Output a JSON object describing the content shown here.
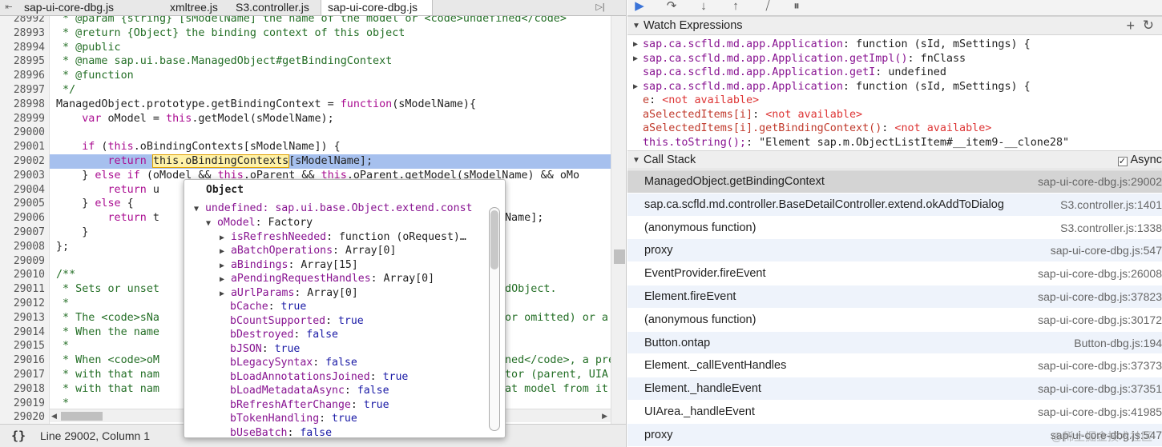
{
  "tabs": [
    {
      "label": "sap-ui-core-dbg.js",
      "active": false
    },
    {
      "label": "xmltree.js",
      "active": false
    },
    {
      "label": "S3.controller.js",
      "active": false
    },
    {
      "label": "sap-ui-core-dbg.js",
      "active": true
    }
  ],
  "editor": {
    "lines": [
      "28992",
      "28993",
      "28994",
      "28995",
      "28996",
      "28997",
      "28998",
      "28999",
      "29000",
      "29001",
      "29002",
      "29003",
      "29004",
      "29005",
      "29006",
      "29007",
      "29008",
      "29009",
      "29010",
      "29011",
      "29012",
      "29013",
      "29014",
      "29015",
      "29016",
      "29017",
      "29018",
      "29019",
      "29020"
    ],
    "code": {
      "l0": " * @param {string} [sModelName] the name of the model or <code>undefined</code>",
      "l1": " * @return {Object} the binding context of this object",
      "l2": " * @public",
      "l3": " * @name sap.ui.base.ManagedObject#getBindingContext",
      "l4": " * @function",
      "l5": " */",
      "l6a": "ManagedObject.prototype.getBindingContext = ",
      "l6b": "function",
      "l6c": "(sModelName){",
      "l7a": "    ",
      "l7b": "var",
      "l7c": " oModel = ",
      "l7d": "this",
      "l7e": ".getModel(sModelName);",
      "l9a": "    ",
      "l9b": "if",
      "l9c": " (",
      "l9d": "this",
      "l9e": ".oBindingContexts[sModelName]) {",
      "l10a": "        ",
      "l10b": "return",
      "l10c": " ",
      "l10d": "this.oBindingContexts",
      "l10e": "[sModelName];",
      "l11a": "    } ",
      "l11b": "else if",
      "l11c": " (oModel && ",
      "l11d": "this",
      "l11e": ".oParent && ",
      "l11f": "this",
      "l11g": ".oParent.getModel(sModelName) && oMo",
      "l12a": "        ",
      "l12b": "return",
      "l12c": " u",
      "l13a": "    } ",
      "l13b": "else",
      "l13c": " {",
      "l14a": "        ",
      "l14b": "return",
      "l14c": " t",
      "l14d": "Name];",
      "l15": "    }",
      "l16": "};",
      "l18": "/**",
      "l19a": " * Sets or unset",
      "l19b": "edObject.",
      "l20": " *",
      "l21a": " * The <code>sNa",
      "l21b": "or omitted) or a",
      "l22a": " * When the name",
      "l23": " *",
      "l24a": " * When <code>oM",
      "l24b": "ned</code>, a pre",
      "l25a": " * with that nam",
      "l25b": "tor (parent, UIA",
      "l26a": " * with that nam",
      "l26b": "at model from it",
      "l27": " *"
    }
  },
  "status": {
    "text": "Line 29002, Column 1",
    "braces": "{}"
  },
  "popover": {
    "title": "Object",
    "root": "undefined: sap.ui.base.Object.extend.const",
    "model": {
      "key": "oModel",
      "value": "Factory"
    },
    "props": [
      {
        "key": "isRefreshNeeded",
        "value": "function (oRequest)…",
        "type": "obj",
        "expand": true
      },
      {
        "key": "aBatchOperations",
        "value": "Array[0]",
        "type": "obj",
        "expand": true
      },
      {
        "key": "aBindings",
        "value": "Array[15]",
        "type": "obj",
        "expand": true
      },
      {
        "key": "aPendingRequestHandles",
        "value": "Array[0]",
        "type": "obj",
        "expand": true
      },
      {
        "key": "aUrlParams",
        "value": "Array[0]",
        "type": "obj",
        "expand": true
      },
      {
        "key": "bCache",
        "value": "true",
        "type": "bool",
        "expand": false
      },
      {
        "key": "bCountSupported",
        "value": "true",
        "type": "bool",
        "expand": false
      },
      {
        "key": "bDestroyed",
        "value": "false",
        "type": "bool",
        "expand": false
      },
      {
        "key": "bJSON",
        "value": "true",
        "type": "bool",
        "expand": false
      },
      {
        "key": "bLegacySyntax",
        "value": "false",
        "type": "bool",
        "expand": false
      },
      {
        "key": "bLoadAnnotationsJoined",
        "value": "true",
        "type": "bool",
        "expand": false
      },
      {
        "key": "bLoadMetadataAsync",
        "value": "false",
        "type": "bool",
        "expand": false
      },
      {
        "key": "bRefreshAfterChange",
        "value": "true",
        "type": "bool",
        "expand": false
      },
      {
        "key": "bTokenHandling",
        "value": "true",
        "type": "bool",
        "expand": false
      },
      {
        "key": "bUseBatch",
        "value": "false",
        "type": "bool",
        "expand": false
      }
    ]
  },
  "watch": {
    "title": "Watch Expressions",
    "items": [
      {
        "name": "sap.ca.scfld.md.app.Application",
        "value": "function (sId, mSettings) {",
        "expand": true,
        "na": false
      },
      {
        "name": "sap.ca.scfld.md.app.Application.getImpl()",
        "value": "fnClass",
        "expand": true,
        "na": false
      },
      {
        "name": "sap.ca.scfld.md.app.Application.getI",
        "value": "undefined",
        "expand": false,
        "na": false
      },
      {
        "name": "sap.ca.scfld.md.app.Application",
        "value": "function (sId, mSettings) {",
        "expand": true,
        "na": false
      },
      {
        "name": "e",
        "value": "<not available>",
        "expand": false,
        "na": true
      },
      {
        "name": "aSelectedItems[i]",
        "value": "<not available>",
        "expand": false,
        "na": true
      },
      {
        "name": "aSelectedItems[i].getBindingContext()",
        "value": "<not available>",
        "expand": false,
        "na": true
      },
      {
        "name": "this.toString();",
        "value": "\"Element sap.m.ObjectListItem#__item9-__clone28\"",
        "expand": false,
        "na": false
      }
    ]
  },
  "callstack": {
    "title": "Call Stack",
    "async_label": "Async",
    "frames": [
      {
        "fn": "ManagedObject.getBindingContext",
        "loc": "sap-ui-core-dbg.js:29002"
      },
      {
        "fn": "sap.ca.scfld.md.controller.BaseDetailController.extend.okAddToDialog",
        "loc": "S3.controller.js:1401"
      },
      {
        "fn": "(anonymous function)",
        "loc": "S3.controller.js:1338"
      },
      {
        "fn": "proxy",
        "loc": "sap-ui-core-dbg.js:547"
      },
      {
        "fn": "EventProvider.fireEvent",
        "loc": "sap-ui-core-dbg.js:26008"
      },
      {
        "fn": "Element.fireEvent",
        "loc": "sap-ui-core-dbg.js:37823"
      },
      {
        "fn": "(anonymous function)",
        "loc": "sap-ui-core-dbg.js:30172"
      },
      {
        "fn": "Button.ontap",
        "loc": "Button-dbg.js:194"
      },
      {
        "fn": "Element._callEventHandles",
        "loc": "sap-ui-core-dbg.js:37373"
      },
      {
        "fn": "Element._handleEvent",
        "loc": "sap-ui-core-dbg.js:37351"
      },
      {
        "fn": "UIArea._handleEvent",
        "loc": "sap-ui-core-dbg.js:41985"
      },
      {
        "fn": "proxy",
        "loc": "sap-ui-core-dbg.js:547"
      }
    ]
  },
  "watermark": "@稀土掘金技术社区",
  "colors": {
    "highlight": "#a6c0ee",
    "comment": "#236e25",
    "keyword": "#aa0d91",
    "property": "#881391"
  }
}
